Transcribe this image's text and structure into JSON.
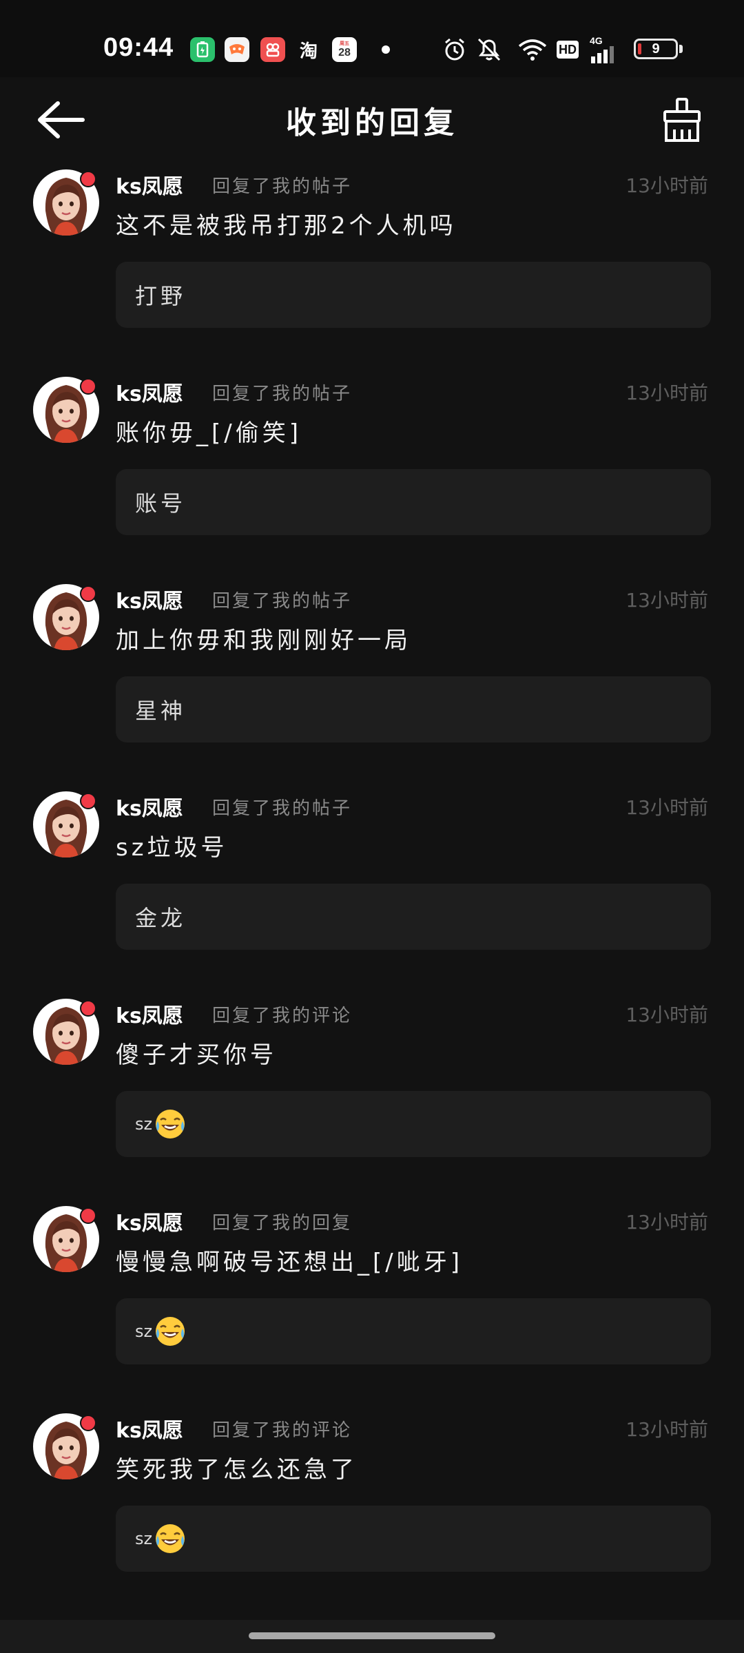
{
  "status_bar": {
    "time": "09:44",
    "apps": [
      {
        "name": "battery-app",
        "glyph": "▯",
        "color": "#2bc06c"
      },
      {
        "name": "game-app",
        "glyph": "◆",
        "color": "#f0f0f0"
      },
      {
        "name": "shopping-app",
        "glyph": "✿",
        "color": "#f04b4b"
      },
      {
        "name": "taobao-app",
        "glyph": "淘",
        "color": "#121212"
      },
      {
        "name": "calendar-app",
        "glyph": "28",
        "color": "#ffffff"
      }
    ],
    "network_label": "HD",
    "network_type": "4G",
    "battery_level": "9"
  },
  "header": {
    "title": "收到的回复"
  },
  "replies": [
    {
      "username": "ks凤愿",
      "action": "回复了我的帖子",
      "time": "13小时前",
      "reply": "这不是被我吊打那2个人机吗",
      "quote": "打野",
      "quote_emoji": false
    },
    {
      "username": "ks凤愿",
      "action": "回复了我的帖子",
      "time": "13小时前",
      "reply": "账你毋_[/偷笑]",
      "quote": "账号",
      "quote_emoji": false
    },
    {
      "username": "ks凤愿",
      "action": "回复了我的帖子",
      "time": "13小时前",
      "reply": "加上你毋和我刚刚好一局",
      "quote": "星神",
      "quote_emoji": false
    },
    {
      "username": "ks凤愿",
      "action": "回复了我的帖子",
      "time": "13小时前",
      "reply": "sz垃圾号",
      "quote": "金龙",
      "quote_emoji": false
    },
    {
      "username": "ks凤愿",
      "action": "回复了我的评论",
      "time": "13小时前",
      "reply": "傻子才买你号",
      "quote": "sz",
      "quote_emoji": true
    },
    {
      "username": "ks凤愿",
      "action": "回复了我的回复",
      "time": "13小时前",
      "reply": "慢慢急啊破号还想出_[/呲牙]",
      "quote": "sz",
      "quote_emoji": true
    },
    {
      "username": "ks凤愿",
      "action": "回复了我的评论",
      "time": "13小时前",
      "reply": "笑死我了怎么还急了",
      "quote": "sz",
      "quote_emoji": true
    }
  ]
}
